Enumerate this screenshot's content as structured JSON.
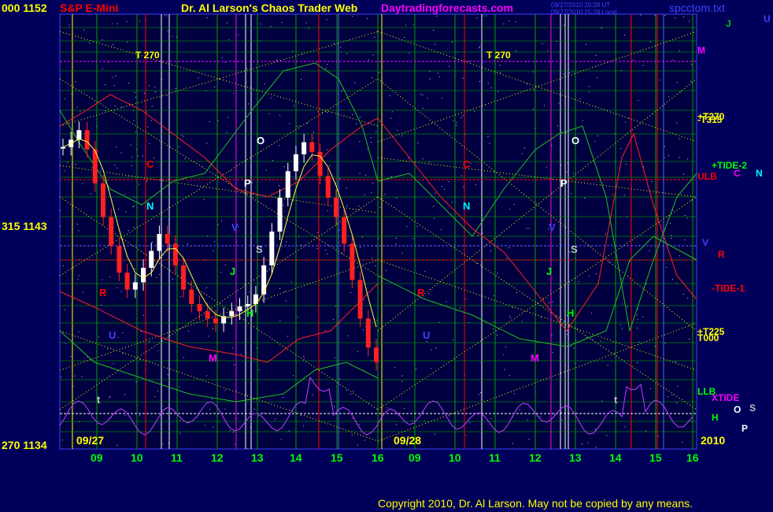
{
  "header": {
    "left_value": "000  1152",
    "symbol": "S&P E-Mini",
    "title": "Dr. Al Larson's Chaos Trader Web",
    "site": "Daytradingforecasts.com",
    "stamp1": "09/27/2010 20:28 UT",
    "stamp2": "09/27/2010 15:28 Local",
    "file": "spcctom.txt"
  },
  "footer": {
    "copyright": "Copyright 2010, Dr. Al Larson. May not be copied by any means."
  },
  "colors": {
    "background": "#00005a",
    "plot": "#000040",
    "grid_green": "#00a000",
    "grid_yellow": "#ffff00",
    "grid_blue": "#6060ff",
    "grid_red": "#ff0000",
    "grid_white": "#ffffff",
    "grid_magenta": "#ff00ff"
  },
  "chart_data": {
    "type": "line",
    "y_left_labels": [
      {
        "text": "000  1152",
        "value": 1152
      },
      {
        "text": "315  1143",
        "value": 1143
      },
      {
        "text": "270  1134",
        "value": 1134
      }
    ],
    "ylim": [
      1134,
      1152
    ],
    "panels": [
      {
        "date": "09/27",
        "hours": [
          "09",
          "10",
          "11",
          "12",
          "13",
          "14",
          "15",
          "16"
        ]
      },
      {
        "date": "09/28",
        "hours": [
          "09",
          "10",
          "11",
          "12",
          "13",
          "14",
          "15",
          "16"
        ]
      }
    ],
    "year_label": "2010",
    "series": [
      {
        "name": "price",
        "values_panel1": [
          1146.5,
          1146.8,
          1147.2,
          1146.4,
          1145.0,
          1143.6,
          1142.4,
          1141.3,
          1140.6,
          1140.9,
          1141.5,
          1142.2,
          1142.9,
          1142.5,
          1141.6,
          1140.6,
          1140.0,
          1139.7,
          1139.4,
          1139.2,
          1139.5,
          1139.7,
          1139.9,
          1140.0,
          1140.4,
          1141.6,
          1143.0,
          1144.4,
          1145.5,
          1146.2,
          1146.7,
          1146.3,
          1145.3,
          1144.4,
          1143.6,
          1142.5,
          1141.0,
          1139.4,
          1138.2,
          1137.6
        ]
      }
    ],
    "chart_labels": [
      {
        "text": "T  270",
        "color": "#ffff00"
      },
      {
        "text": "O",
        "color": "#ffffff"
      },
      {
        "text": "C",
        "color": "#ff0000"
      },
      {
        "text": "P",
        "color": "#ffffff"
      },
      {
        "text": "N",
        "color": "#00ffff"
      },
      {
        "text": "V",
        "color": "#4040ff"
      },
      {
        "text": "S",
        "color": "#c0c0c0"
      },
      {
        "text": "R",
        "color": "#ff0000"
      },
      {
        "text": "J",
        "color": "#00ff00"
      },
      {
        "text": "H",
        "color": "#00ff00"
      },
      {
        "text": "M",
        "color": "#ff00ff"
      },
      {
        "text": "t",
        "color": "#c0c0c0"
      },
      {
        "text": "U",
        "color": "#4040ff"
      }
    ],
    "right_labels": [
      {
        "text": "J",
        "color": "#00c000"
      },
      {
        "text": "U",
        "color": "#4040ff"
      },
      {
        "text": "M",
        "color": "#ff00ff"
      },
      {
        "text": "+T270",
        "color": "#ffff00"
      },
      {
        "text": "-T315",
        "color": "#ffff00"
      },
      {
        "text": "+TIDE-2",
        "color": "#00ff00"
      },
      {
        "text": "ULB",
        "color": "#ff0000"
      },
      {
        "text": "C",
        "color": "#ff00ff"
      },
      {
        "text": "N",
        "color": "#00ffff"
      },
      {
        "text": "V",
        "color": "#4040ff"
      },
      {
        "text": "R",
        "color": "#ff0000"
      },
      {
        "text": "-TIDE-1",
        "color": "#ff0000"
      },
      {
        "text": "+T225",
        "color": "#ffff00"
      },
      {
        "text": "T000",
        "color": "#ffff00"
      },
      {
        "text": "LLB",
        "color": "#00ff00"
      },
      {
        "text": "XTIDE",
        "color": "#ff00ff"
      },
      {
        "text": "O",
        "color": "#ffffff"
      },
      {
        "text": "S",
        "color": "#c0c0c0"
      },
      {
        "text": "H",
        "color": "#00ff00"
      },
      {
        "text": "P",
        "color": "#ffffff"
      }
    ]
  }
}
